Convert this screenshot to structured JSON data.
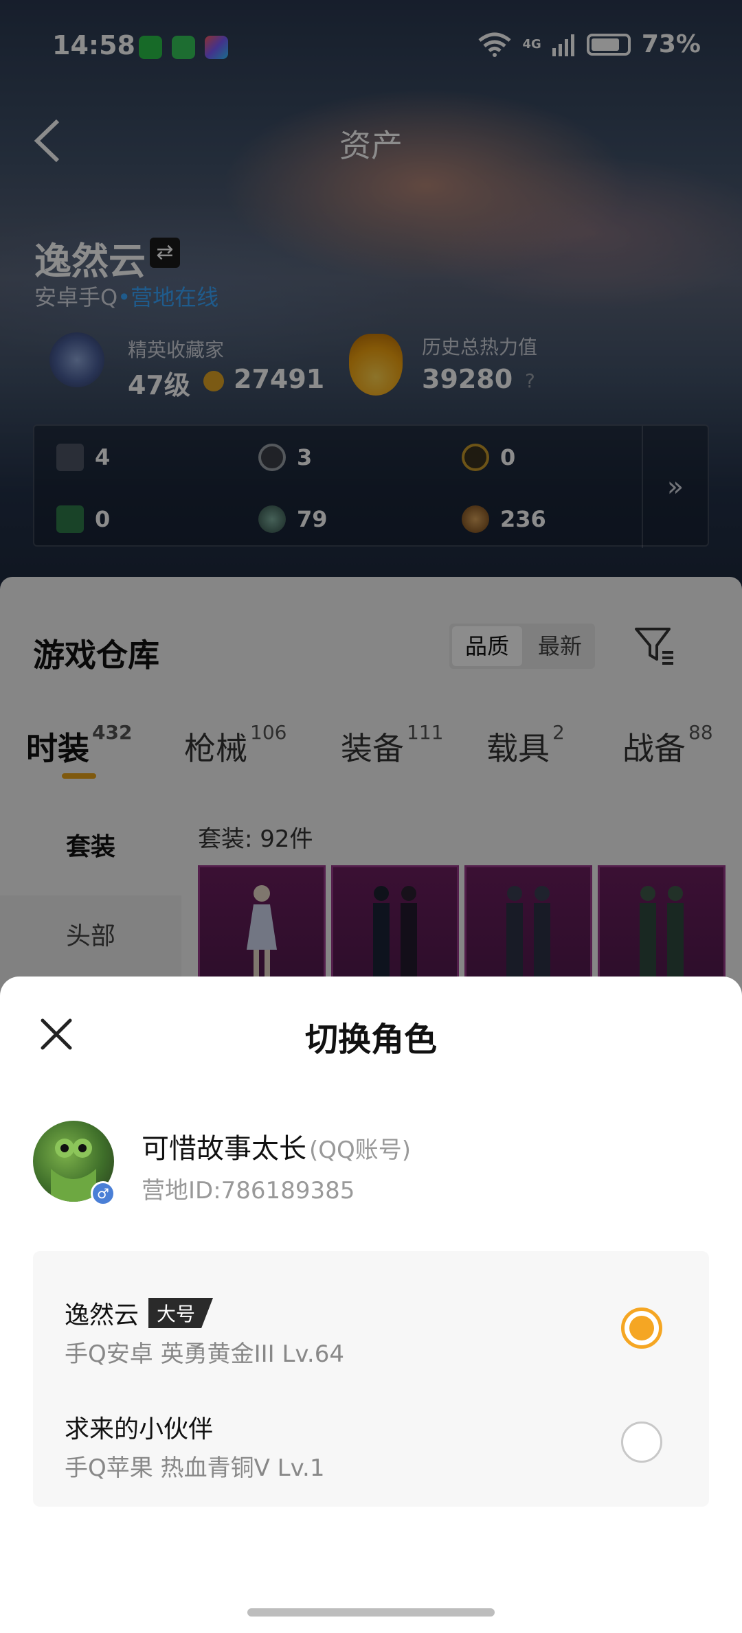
{
  "status_bar": {
    "time": "14:58",
    "network": "4G",
    "battery": "73%"
  },
  "nav": {
    "title": "资产"
  },
  "profile": {
    "name": "逸然云",
    "platform": "安卓手Q",
    "online_status": "营地在线",
    "collector_label": "精英收藏家",
    "collector_level": "47级",
    "collector_points": "27491",
    "heat_label": "历史总热力值",
    "heat_value": "39280",
    "heat_help": "?"
  },
  "resources": [
    {
      "value": "4",
      "icon": "card-icon"
    },
    {
      "value": "3",
      "icon": "coin-icon"
    },
    {
      "value": "0",
      "icon": "badge-icon"
    },
    {
      "value": "0",
      "icon": "ticket-icon"
    },
    {
      "value": "79",
      "icon": "orb-icon"
    },
    {
      "value": "236",
      "icon": "medal-icon"
    }
  ],
  "resources_more": "»",
  "warehouse": {
    "title": "游戏仓库",
    "sort_options": [
      "品质",
      "最新"
    ],
    "tabs": [
      {
        "label": "时装",
        "count": "432"
      },
      {
        "label": "枪械",
        "count": "106"
      },
      {
        "label": "装备",
        "count": "111"
      },
      {
        "label": "载具",
        "count": "2"
      },
      {
        "label": "战备",
        "count": "88"
      }
    ],
    "side_items": [
      "套装",
      "头部"
    ],
    "count_label": "套装: 92件"
  },
  "colors": {
    "accent_orange": "#f5a623",
    "tab_underline": "#e7a21a",
    "online_blue": "#3aa7ff",
    "card_purple": "#6b1e5e"
  },
  "switch_role": {
    "title": "切换角色",
    "account_name": "可惜故事太长",
    "account_type": "(QQ账号)",
    "account_id": "营地ID:786189385",
    "roles": [
      {
        "name": "逸然云",
        "badge": "大号",
        "info": "手Q安卓  英勇黄金III  Lv.64",
        "selected": true
      },
      {
        "name": "求来的小伙伴",
        "badge": "",
        "info": "手Q苹果  热血青铜V  Lv.1",
        "selected": false
      }
    ]
  }
}
